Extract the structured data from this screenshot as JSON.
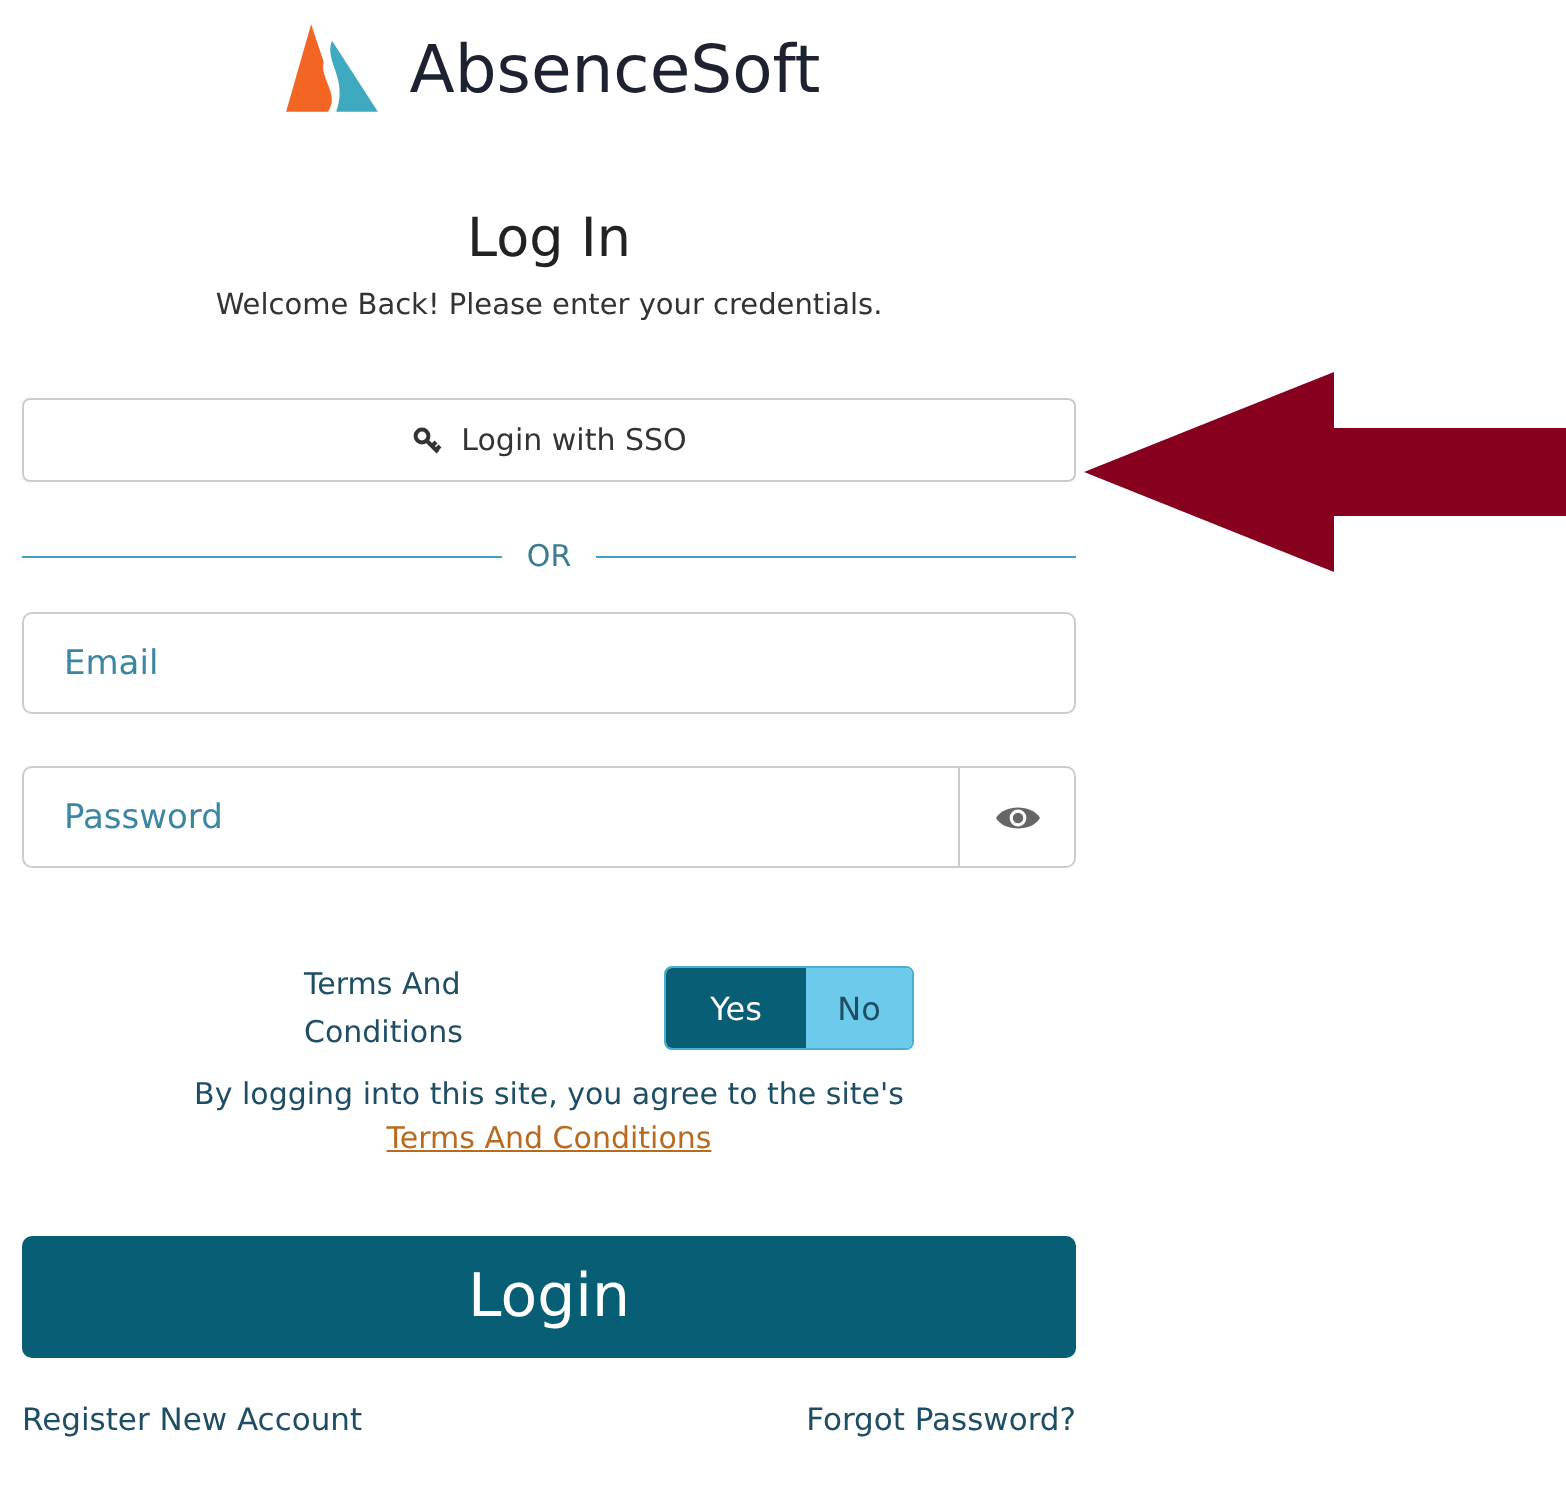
{
  "brand": {
    "name": "AbsenceSoft"
  },
  "heading": "Log In",
  "subtitle": "Welcome Back! Please enter your credentials.",
  "sso_button": {
    "label": "Login with SSO"
  },
  "divider": "OR",
  "fields": [
    {
      "kind": "text",
      "placeholder": "Email"
    },
    {
      "kind": "password",
      "placeholder": "Password"
    }
  ],
  "terms": {
    "label": "Terms And Conditions",
    "options": [
      {
        "label": "Yes",
        "selected": true
      },
      {
        "label": "No",
        "selected": false
      }
    ],
    "notice": "By logging into this site, you agree to the site's",
    "link": "Terms And Conditions"
  },
  "login_button": "Login",
  "footer_links": [
    "Register New Account",
    "Forgot Password?"
  ]
}
